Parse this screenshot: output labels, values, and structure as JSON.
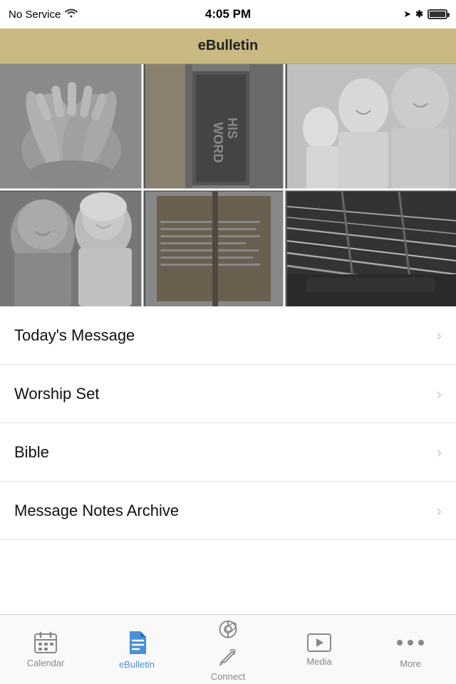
{
  "status_bar": {
    "carrier": "No Service",
    "time": "4:05 PM",
    "wifi": true,
    "bluetooth": true,
    "battery": "full"
  },
  "nav": {
    "title": "eBulletin"
  },
  "menu": {
    "items": [
      {
        "id": "todays-message",
        "label": "Today's Message"
      },
      {
        "id": "worship-set",
        "label": "Worship Set"
      },
      {
        "id": "bible",
        "label": "Bible"
      },
      {
        "id": "message-notes-archive",
        "label": "Message Notes Archive"
      }
    ]
  },
  "tabs": [
    {
      "id": "calendar",
      "label": "Calendar",
      "icon": "calendar",
      "active": false
    },
    {
      "id": "ebulletin",
      "label": "eBulletin",
      "icon": "document",
      "active": true
    },
    {
      "id": "connect",
      "label": "Connect",
      "icon": "connect",
      "active": false
    },
    {
      "id": "media",
      "label": "Media",
      "icon": "media",
      "active": false
    },
    {
      "id": "more",
      "label": "More",
      "icon": "more",
      "active": false
    }
  ]
}
